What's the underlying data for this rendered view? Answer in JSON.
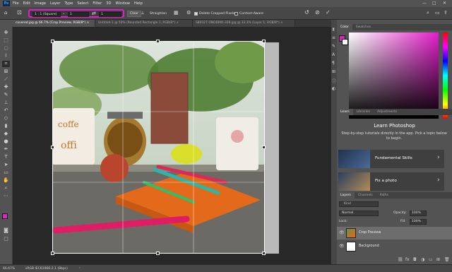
{
  "app": {
    "logo": "Ps"
  },
  "menubar": {
    "items": [
      "File",
      "Edit",
      "Image",
      "Layer",
      "Type",
      "Select",
      "Filter",
      "3D",
      "Window",
      "Help"
    ],
    "window_controls": [
      "—",
      "□",
      "✕"
    ]
  },
  "options_bar": {
    "ratio_preset": "1 : 1 (Square)",
    "ratio_width": "1",
    "ratio_height": "1",
    "swap_icon": "⇄",
    "clear_label": "Clear",
    "straighten_label": "Straighten",
    "delete_cropped_label": "Delete Cropped Pixels",
    "delete_cropped_checked": true,
    "content_aware_label": "Content-Aware",
    "content_aware_checked": false
  },
  "tabs": [
    {
      "label": "covered.jpg @ 66.7% (Crop Preview, RGB/8*) ×",
      "active": true
    },
    {
      "label": "Untitled-1 @ 50% (Rounded Rectangle 1, RGB/8*) ×",
      "active": false
    },
    {
      "label": "S89327-ONODMO-339.jpg @ 33.3% (Layer 1, RGB/8*) ×",
      "active": false
    }
  ],
  "status_bar": {
    "zoom": "66.67%",
    "profile": "sRGB IEC61966-2.1 (8bpc)",
    "arrow": "›"
  },
  "color_panel": {
    "tabs": [
      "Color",
      "Swatches"
    ],
    "foreground": "#e41ecb",
    "background": "#ffffff"
  },
  "learn_panel": {
    "tabs": [
      "Learn",
      "Libraries",
      "Adjustments"
    ],
    "title": "Learn Photoshop",
    "subtitle": "Step-by-step tutorials directly in the app. Pick a topic below to begin.",
    "cards": [
      {
        "label": "Fundamental Skills",
        "arrow": "›"
      },
      {
        "label": "Fix a photo",
        "arrow": "›"
      }
    ]
  },
  "layers_panel": {
    "tabs": [
      "Layers",
      "Channels",
      "Paths"
    ],
    "search_placeholder": "Kind",
    "blend_mode": "Normal",
    "opacity_label": "Opacity:",
    "opacity_value": "100%",
    "lock_label": "Lock:",
    "fill_label": "Fill:",
    "fill_value": "100%",
    "layers": [
      {
        "name": "Crop Preview",
        "selected": true
      },
      {
        "name": "Background",
        "selected": false
      }
    ]
  },
  "accent": "#e41ecb"
}
